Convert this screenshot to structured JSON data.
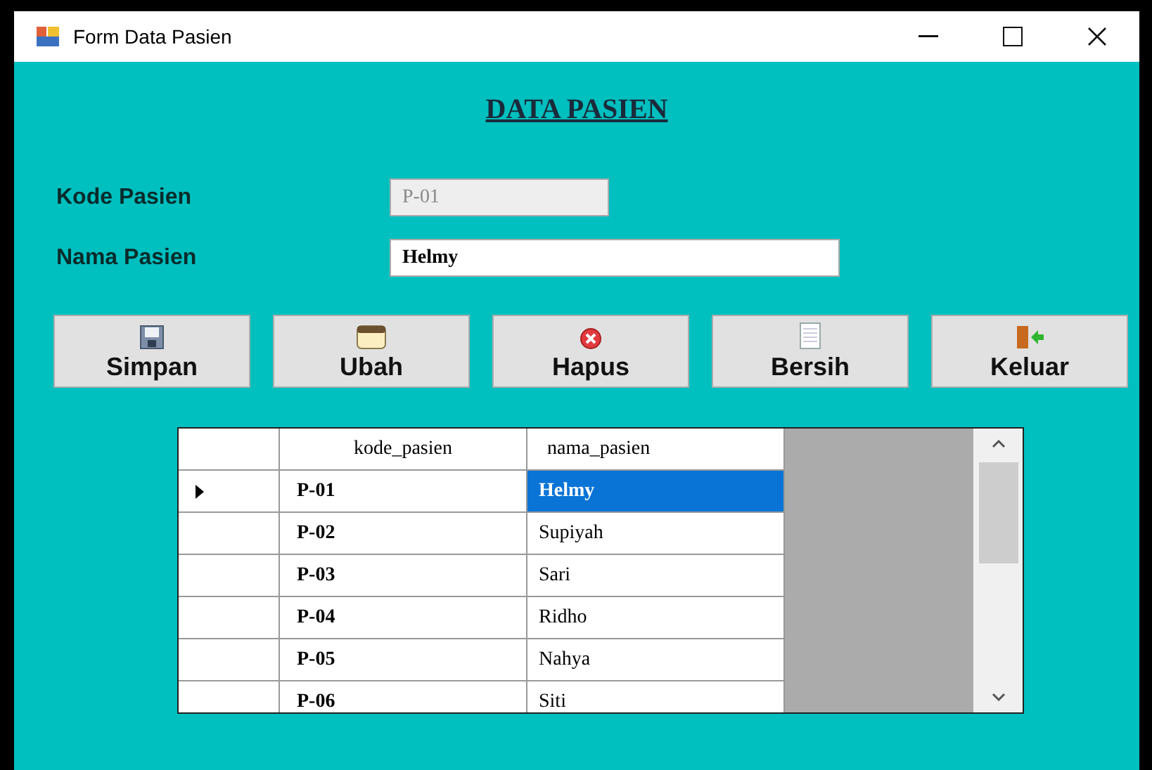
{
  "window": {
    "title": "Form Data Pasien"
  },
  "heading": "DATA PASIEN",
  "fields": [
    {
      "label": "Kode Pasien",
      "value": "P-01",
      "disabled": true
    },
    {
      "label": "Nama Pasien",
      "value": "Helmy",
      "disabled": false
    }
  ],
  "buttons": [
    {
      "label": "Simpan",
      "kind": "save"
    },
    {
      "label": "Ubah",
      "kind": "edit"
    },
    {
      "label": "Hapus",
      "kind": "delete"
    },
    {
      "label": "Bersih",
      "kind": "clear"
    },
    {
      "label": "Keluar",
      "kind": "exit"
    }
  ],
  "table": {
    "columns": [
      "kode_pasien",
      "nama_pasien"
    ],
    "rows": [
      {
        "cells": [
          "P-01",
          "Helmy"
        ],
        "selected": true
      },
      {
        "cells": [
          "P-02",
          "Supiyah"
        ],
        "selected": false
      },
      {
        "cells": [
          "P-03",
          "Sari"
        ],
        "selected": false
      },
      {
        "cells": [
          "P-04",
          "Ridho"
        ],
        "selected": false
      },
      {
        "cells": [
          "P-05",
          "Nahya"
        ],
        "selected": false
      },
      {
        "cells": [
          "P-06",
          "Siti"
        ],
        "selected": false
      }
    ]
  }
}
